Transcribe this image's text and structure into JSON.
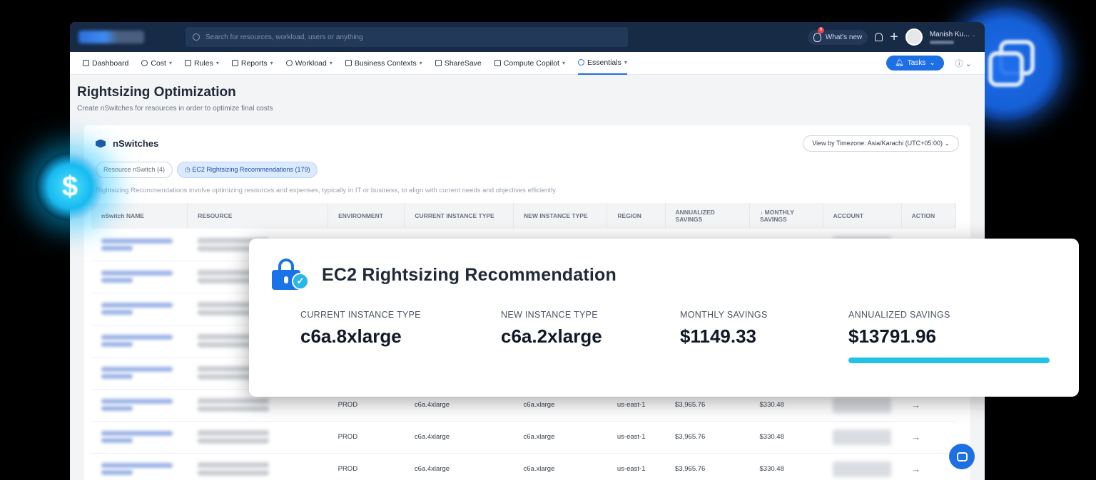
{
  "topbar": {
    "search_placeholder": "Search for resources, workload, users or anything",
    "whats_new": "What's new",
    "notification_count": "9",
    "user_name": "Manish Ku..."
  },
  "nav": {
    "items": [
      {
        "label": "Dashboard"
      },
      {
        "label": "Cost"
      },
      {
        "label": "Rules"
      },
      {
        "label": "Reports"
      },
      {
        "label": "Workload"
      },
      {
        "label": "Business Contexts"
      },
      {
        "label": "ShareSave"
      },
      {
        "label": "Compute Copilot"
      },
      {
        "label": "Essentials"
      }
    ],
    "tasks_label": "Tasks"
  },
  "page": {
    "title": "Rightsizing Optimization",
    "subtitle": "Create nSwitches for resources in order to optimize final costs"
  },
  "panel": {
    "title": "nSwitches",
    "timezone": "View by Timezone: Asia/Karachi (UTC+05:00)",
    "chips": [
      "Resource nSwitch (4)",
      "EC2 Rightsizing Recommendations (179)"
    ],
    "description": "Rightsizing Recommendations involve optimizing resources and expenses, typically in IT or business, to align with current needs and objectives efficiently."
  },
  "table": {
    "headers": [
      "nSwitch NAME",
      "RESOURCE",
      "ENVIRONMENT",
      "CURRENT INSTANCE TYPE",
      "NEW INSTANCE TYPE",
      "REGION",
      "ANNUALIZED SAVINGS",
      "MONTHLY SAVINGS",
      "ACCOUNT",
      "ACTION"
    ],
    "rows": [
      {
        "env": "",
        "current": "",
        "new": "",
        "region": "",
        "annual": "",
        "monthly": ""
      },
      {
        "env": "",
        "current": "",
        "new": "",
        "region": "",
        "annual": "",
        "monthly": ""
      },
      {
        "env": "",
        "current": "",
        "new": "",
        "region": "",
        "annual": "",
        "monthly": ""
      },
      {
        "env": "",
        "current": "",
        "new": "",
        "region": "",
        "annual": "",
        "monthly": ""
      },
      {
        "env": "",
        "current": "",
        "new": "",
        "region": "",
        "annual": "",
        "monthly": ""
      },
      {
        "env": "PROD",
        "current": "c6a.4xlarge",
        "new": "c6a.xlarge",
        "region": "us-east-1",
        "annual": "$3,965.76",
        "monthly": "$330.48"
      },
      {
        "env": "PROD",
        "current": "c6a.4xlarge",
        "new": "c6a.xlarge",
        "region": "us-east-1",
        "annual": "$3,965.76",
        "monthly": "$330.48"
      },
      {
        "env": "PROD",
        "current": "c6a.4xlarge",
        "new": "c6a.xlarge",
        "region": "us-east-1",
        "annual": "$3,965.76",
        "monthly": "$330.48"
      }
    ]
  },
  "card": {
    "title": "EC2 Rightsizing Recommendation",
    "current_label": "CURRENT INSTANCE TYPE",
    "current_value": "c6a.8xlarge",
    "new_label": "NEW INSTANCE TYPE",
    "new_value": "c6a.2xlarge",
    "monthly_label": "MONTHLY SAVINGS",
    "monthly_value": "$1149.33",
    "annual_label": "ANNUALIZED SAVINGS",
    "annual_value": "$13791.96",
    "annual_progress": 1.0,
    "progress_color": "#22c1e6"
  },
  "colors": {
    "accent": "#1d6fe4",
    "topbar": "#172a46"
  }
}
